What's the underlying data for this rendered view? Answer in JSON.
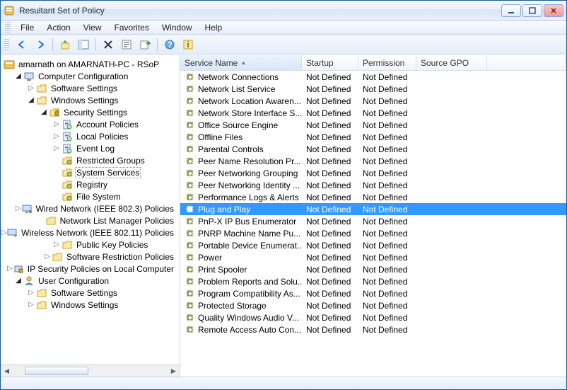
{
  "window": {
    "title": "Resultant Set of Policy"
  },
  "menu": {
    "items": [
      "File",
      "Action",
      "View",
      "Favorites",
      "Window",
      "Help"
    ]
  },
  "toolbar": {
    "icons": [
      "back",
      "forward",
      "up",
      "show-hide-tree",
      "delete",
      "properties",
      "export",
      "help",
      "about"
    ]
  },
  "tree": {
    "root": {
      "label": "amarnath on AMARNATH-PC - RSoP",
      "icon": "rsop"
    },
    "nodes": [
      {
        "indent": 0,
        "twisty": "open",
        "icon": "computer",
        "label": "Computer Configuration"
      },
      {
        "indent": 1,
        "twisty": "closed",
        "icon": "folder",
        "label": "Software Settings"
      },
      {
        "indent": 1,
        "twisty": "open",
        "icon": "folder",
        "label": "Windows Settings"
      },
      {
        "indent": 2,
        "twisty": "open",
        "icon": "security",
        "label": "Security Settings"
      },
      {
        "indent": 3,
        "twisty": "closed",
        "icon": "policy",
        "label": "Account Policies"
      },
      {
        "indent": 3,
        "twisty": "closed",
        "icon": "policy",
        "label": "Local Policies"
      },
      {
        "indent": 3,
        "twisty": "closed",
        "icon": "policy",
        "label": "Event Log"
      },
      {
        "indent": 3,
        "twisty": "none",
        "icon": "folder-g",
        "label": "Restricted Groups"
      },
      {
        "indent": 3,
        "twisty": "none",
        "icon": "folder-g",
        "label": "System Services",
        "selected": true
      },
      {
        "indent": 3,
        "twisty": "none",
        "icon": "folder-g",
        "label": "Registry"
      },
      {
        "indent": 3,
        "twisty": "none",
        "icon": "folder-g",
        "label": "File System"
      },
      {
        "indent": 3,
        "twisty": "closed",
        "icon": "wired",
        "label": "Wired Network (IEEE 802.3) Policies"
      },
      {
        "indent": 3,
        "twisty": "none",
        "icon": "folder",
        "label": "Network List Manager Policies"
      },
      {
        "indent": 3,
        "twisty": "closed",
        "icon": "wireless",
        "label": "Wireless Network (IEEE 802.11) Policies"
      },
      {
        "indent": 3,
        "twisty": "closed",
        "icon": "folder",
        "label": "Public Key Policies"
      },
      {
        "indent": 3,
        "twisty": "closed",
        "icon": "folder",
        "label": "Software Restriction Policies"
      },
      {
        "indent": 3,
        "twisty": "closed",
        "icon": "ipsec",
        "label": "IP Security Policies on Local Computer"
      },
      {
        "indent": 0,
        "twisty": "open",
        "icon": "user",
        "label": "User Configuration"
      },
      {
        "indent": 1,
        "twisty": "closed",
        "icon": "folder",
        "label": "Software Settings"
      },
      {
        "indent": 1,
        "twisty": "closed",
        "icon": "folder",
        "label": "Windows Settings"
      }
    ]
  },
  "list": {
    "columns": [
      {
        "label": "Service Name",
        "class": "col-name",
        "sorted": true
      },
      {
        "label": "Startup",
        "class": "col-startup"
      },
      {
        "label": "Permission",
        "class": "col-perm"
      },
      {
        "label": "Source GPO",
        "class": "col-gpo"
      }
    ],
    "selected_index": 11,
    "rows": [
      {
        "name": "Network Connections",
        "startup": "Not Defined",
        "perm": "Not Defined",
        "gpo": ""
      },
      {
        "name": "Network List Service",
        "startup": "Not Defined",
        "perm": "Not Defined",
        "gpo": ""
      },
      {
        "name": "Network Location Awaren...",
        "startup": "Not Defined",
        "perm": "Not Defined",
        "gpo": ""
      },
      {
        "name": "Network Store Interface S...",
        "startup": "Not Defined",
        "perm": "Not Defined",
        "gpo": ""
      },
      {
        "name": "Office Source Engine",
        "startup": "Not Defined",
        "perm": "Not Defined",
        "gpo": ""
      },
      {
        "name": "Offline Files",
        "startup": "Not Defined",
        "perm": "Not Defined",
        "gpo": ""
      },
      {
        "name": "Parental Controls",
        "startup": "Not Defined",
        "perm": "Not Defined",
        "gpo": ""
      },
      {
        "name": "Peer Name Resolution Pr...",
        "startup": "Not Defined",
        "perm": "Not Defined",
        "gpo": ""
      },
      {
        "name": "Peer Networking Grouping",
        "startup": "Not Defined",
        "perm": "Not Defined",
        "gpo": ""
      },
      {
        "name": "Peer Networking Identity ...",
        "startup": "Not Defined",
        "perm": "Not Defined",
        "gpo": ""
      },
      {
        "name": "Performance Logs & Alerts",
        "startup": "Not Defined",
        "perm": "Not Defined",
        "gpo": ""
      },
      {
        "name": "Plug and Play",
        "startup": "Not Defined",
        "perm": "Not Defined",
        "gpo": ""
      },
      {
        "name": "PnP-X IP Bus Enumerator",
        "startup": "Not Defined",
        "perm": "Not Defined",
        "gpo": ""
      },
      {
        "name": "PNRP Machine Name Pu...",
        "startup": "Not Defined",
        "perm": "Not Defined",
        "gpo": ""
      },
      {
        "name": "Portable Device Enumerat...",
        "startup": "Not Defined",
        "perm": "Not Defined",
        "gpo": ""
      },
      {
        "name": "Power",
        "startup": "Not Defined",
        "perm": "Not Defined",
        "gpo": ""
      },
      {
        "name": "Print Spooler",
        "startup": "Not Defined",
        "perm": "Not Defined",
        "gpo": ""
      },
      {
        "name": "Problem Reports and Solu...",
        "startup": "Not Defined",
        "perm": "Not Defined",
        "gpo": ""
      },
      {
        "name": "Program Compatibility As...",
        "startup": "Not Defined",
        "perm": "Not Defined",
        "gpo": ""
      },
      {
        "name": "Protected Storage",
        "startup": "Not Defined",
        "perm": "Not Defined",
        "gpo": ""
      },
      {
        "name": "Quality Windows Audio V...",
        "startup": "Not Defined",
        "perm": "Not Defined",
        "gpo": ""
      },
      {
        "name": "Remote Access Auto Con...",
        "startup": "Not Defined",
        "perm": "Not Defined",
        "gpo": ""
      }
    ]
  }
}
